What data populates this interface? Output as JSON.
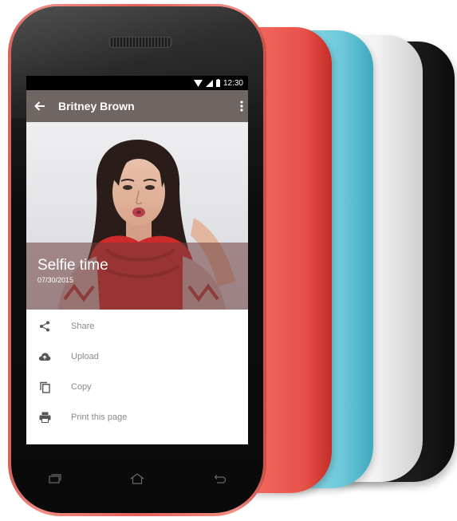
{
  "status_bar": {
    "time": "12:30"
  },
  "app_bar": {
    "title": "Britney Brown",
    "back_icon": "arrow-back-icon",
    "more_icon": "more-vert-icon"
  },
  "photo": {
    "caption_title": "Selfie time",
    "caption_date": "07/30/2015"
  },
  "menu": {
    "items": [
      {
        "label": "Share",
        "icon": "share-icon"
      },
      {
        "label": "Upload",
        "icon": "cloud-upload-icon"
      },
      {
        "label": "Copy",
        "icon": "copy-icon"
      },
      {
        "label": "Print this page",
        "icon": "print-icon"
      }
    ]
  },
  "colors": {
    "app_bar": "#6f6563",
    "phone_shell": "#e4625b",
    "cover_blue": "#6fcadb",
    "cover_white": "#f2f2f2",
    "cover_black": "#1e1e1e"
  }
}
